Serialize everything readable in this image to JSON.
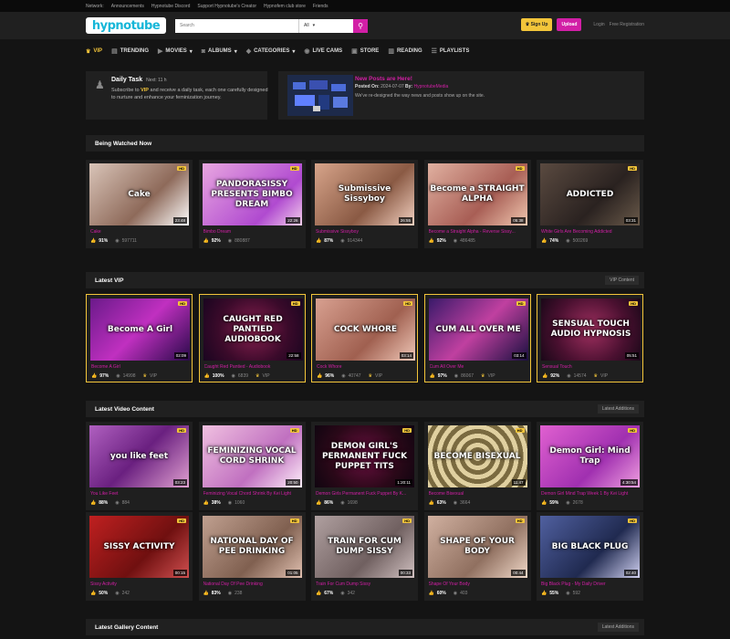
{
  "topbar": {
    "network": "Network:",
    "links": [
      "Announcements",
      "Hypnotube Discord",
      "Support Hypnotube's Creator",
      "Hypnofem club store",
      "Friends"
    ]
  },
  "header": {
    "logo": "hypnotube",
    "search_placeholder": "Search",
    "search_scope": "All",
    "signup": "Sign Up",
    "upload": "Upload",
    "login": "Login",
    "register": "Free Registration"
  },
  "nav": [
    "VIP",
    "TRENDING",
    "MOVIES",
    "ALBUMS",
    "CATEGORIES",
    "LIVE CAMS",
    "STORE",
    "READING",
    "PLAYLISTS"
  ],
  "daily_task": {
    "title": "Daily Task",
    "next": "Next: 11 h",
    "desc_pre": "Subscribe to ",
    "desc_vip": "VIP",
    "desc_post": " and receive a daily task, each one carefully designed to nurture and enhance your feminization journey."
  },
  "news": {
    "title": "New Posts are Here!",
    "posted_label": "Posted On:",
    "posted_date": "2024-07-07",
    "by_label": "By:",
    "author": "HypnotubeMedia",
    "body": "We've re-designed the way news and posts show up on the site."
  },
  "sections": {
    "watched": "Being Watched Now",
    "vip": "Latest VIP",
    "vip_btn": "VIP Content",
    "video": "Latest Video Content",
    "video_btn": "Latest Additions",
    "gallery": "Latest Gallery Content",
    "gallery_btn": "Latest Additions"
  },
  "watched_cards": [
    {
      "title": "Cake",
      "thumb_text": "Cake",
      "dur": "23:48",
      "pct": "91%",
      "views": "597711",
      "hd": "HD",
      "bg": "linear-gradient(135deg,#d9c4b8,#8e6a5a 60%,#ffffff)"
    },
    {
      "title": "Bimbo Dream",
      "thumb_text": "PANDORASISSY PRESENTS BIMBO DREAM",
      "dur": "22:26",
      "pct": "92%",
      "views": "880887",
      "hd": "HD",
      "bg": "linear-gradient(135deg,#e8a6e0,#b04ad0 70%,#f4d0ec)"
    },
    {
      "title": "Submissive Sissyboy",
      "thumb_text": "Submissive Sissyboy",
      "dur": "26:55",
      "pct": "87%",
      "views": "914344",
      "hd": "",
      "bg": "linear-gradient(135deg,#d7a48a,#8a5a44 60%,#f2d0c0)"
    },
    {
      "title": "Become a Straight Alpha - Reverse Sissy...",
      "thumb_text": "Become a STRAIGHT ALPHA",
      "dur": "05:38",
      "pct": "92%",
      "views": "486485",
      "hd": "HD",
      "bg": "linear-gradient(135deg,#e0b0a0,#a85e55 60%,#f0c8b0)"
    },
    {
      "title": "White Girls Are Becoming Addicted",
      "thumb_text": "ADDICTED",
      "dur": "03:31",
      "pct": "74%",
      "views": "500269",
      "hd": "HD",
      "bg": "linear-gradient(135deg,#5a4a40,#2a2220 60%,#6a5a4a)"
    }
  ],
  "vip_cards": [
    {
      "title": "Become A Girl",
      "thumb_text": "Become A Girl",
      "dur": "02:09",
      "pct": "97%",
      "views": "14998",
      "vip": "VIP",
      "hd": "HD",
      "bg": "linear-gradient(135deg,#6a1a8a,#c030c0 50%,#2a0a4a)"
    },
    {
      "title": "Caught Red Pantied - Audiobook",
      "thumb_text": "CAUGHT RED PANTIED AUDIOBOOK",
      "dur": "22:58",
      "pct": "100%",
      "views": "6839",
      "vip": "VIP",
      "hd": "HD",
      "bg": "radial-gradient(circle,#8a2050,#3a0a2a 60%,#1a0520)"
    },
    {
      "title": "Cock Whore",
      "thumb_text": "COCK WHORE",
      "dur": "03:14",
      "pct": "96%",
      "views": "40747",
      "vip": "VIP",
      "hd": "HD",
      "bg": "linear-gradient(135deg,#d8a090,#a06050 60%,#f0c8b8)"
    },
    {
      "title": "Cum All Over Me",
      "thumb_text": "CUM ALL OVER ME",
      "dur": "03:14",
      "pct": "97%",
      "views": "86067",
      "vip": "VIP",
      "hd": "HD",
      "bg": "linear-gradient(135deg,#3a1a6a,#c040a0 50%,#1a1040)"
    },
    {
      "title": "Sensual Touch",
      "thumb_text": "SENSUAL TOUCH AUDIO HYPNOSIS",
      "dur": "05:51",
      "pct": "92%",
      "views": "14574",
      "vip": "VIP",
      "hd": "HD",
      "bg": "radial-gradient(circle,#a03060,#4a1030 60%,#1a0818)"
    }
  ],
  "video_row1": [
    {
      "title": "You Like Feet",
      "thumb_text": "you like feet",
      "dur": "03:23",
      "pct": "88%",
      "views": "884",
      "hd": "HD",
      "bg": "linear-gradient(135deg,#b060c0,#6a2080 50%,#e0a0d0)"
    },
    {
      "title": "Feminizing Vocal Chord Shrink By Kei Light",
      "thumb_text": "FEMINIZING VOCAL CORD SHRINK",
      "dur": "20:50",
      "pct": "38%",
      "views": "1060",
      "hd": "HD",
      "bg": "linear-gradient(135deg,#f0c0e0,#c070c0 60%,#fff0fa)"
    },
    {
      "title": "Demon Girls Permanent Fuck Puppet By K...",
      "thumb_text": "DEMON GIRL'S PERMANENT FUCK PUPPET TITS",
      "dur": "1:20:11",
      "pct": "86%",
      "views": "1698",
      "hd": "HD",
      "bg": "radial-gradient(circle,#6a1040,#2a0818 60%,#100510)"
    },
    {
      "title": "Become Bisexual",
      "thumb_text": "BECOME BISEXUAL",
      "dur": "11:47",
      "pct": "63%",
      "views": "3664",
      "hd": "HD",
      "bg": "repeating-radial-gradient(circle,#e0d0a0 0 5px,#7a6a40 5px 10px)"
    },
    {
      "title": "Demon Girl Mind Trap Week 1 By Kei Light",
      "thumb_text": "Demon Girl: Mind Trap",
      "dur": "4:30:54",
      "pct": "59%",
      "views": "2678",
      "hd": "HD",
      "bg": "linear-gradient(135deg,#e060d0,#a030b0 60%,#f0a0e0)"
    }
  ],
  "video_row2": [
    {
      "title": "Sissy Activity",
      "thumb_text": "SISSY ACTIVITY",
      "dur": "00:15",
      "pct": "50%",
      "views": "242",
      "hd": "HD",
      "bg": "linear-gradient(135deg,#c02020,#701010 60%,#d05050)"
    },
    {
      "title": "National Day Of Pee Drinking",
      "thumb_text": "NATIONAL DAY OF PEE DRINKING",
      "dur": "01:05",
      "pct": "83%",
      "views": "238",
      "hd": "HD",
      "bg": "linear-gradient(135deg,#c0a090,#806050 60%,#e0c0b0)"
    },
    {
      "title": "Train For Cum Dump Sissy",
      "thumb_text": "TRAIN FOR CUM DUMP SISSY",
      "dur": "00:33",
      "pct": "67%",
      "views": "342",
      "hd": "HD",
      "bg": "linear-gradient(135deg,#b0a0a0,#706060 60%,#d0c0c0)"
    },
    {
      "title": "Shape Of Your Body",
      "thumb_text": "SHAPE OF YOUR BODY",
      "dur": "00:44",
      "pct": "60%",
      "views": "403",
      "hd": "HD",
      "bg": "linear-gradient(135deg,#d0b0a0,#907060 60%,#f0d8c8)"
    },
    {
      "title": "Big Black Plug - My Daily Driver",
      "thumb_text": "BIG BLACK PLUG",
      "dur": "02:40",
      "pct": "55%",
      "views": "592",
      "hd": "HD",
      "bg": "linear-gradient(135deg,#5060a0,#202a50 60%,#d0d0f0)"
    }
  ]
}
